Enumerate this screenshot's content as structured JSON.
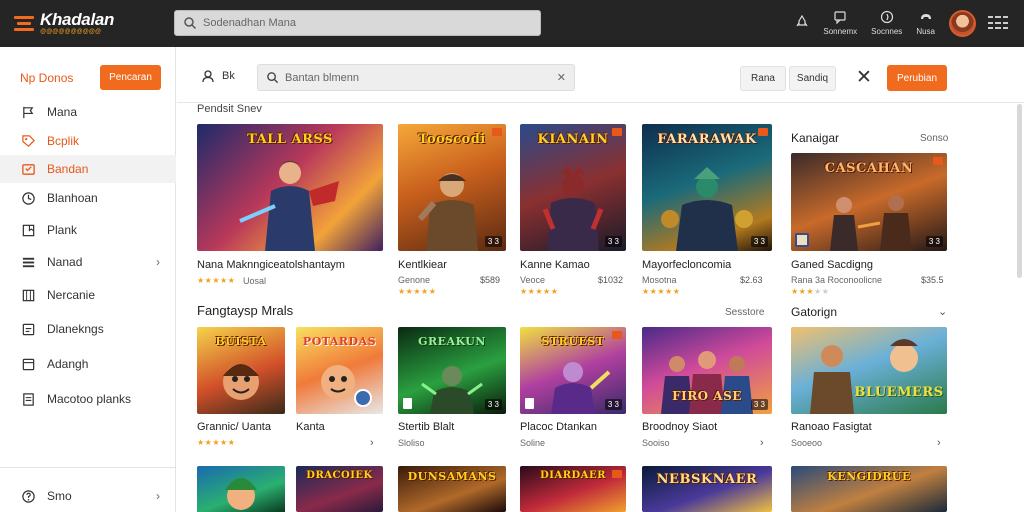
{
  "colors": {
    "accent": "#f06b1d",
    "topbar": "#252525",
    "sidebar_active_bg": "#f2f2f2",
    "star": "#f0a21d"
  },
  "app": {
    "title": "Khadalan",
    "tagline": "@@@@@@@@@@"
  },
  "top_search": {
    "placeholder": "Sodenadhan Mana"
  },
  "top_actions": [
    {
      "label": "",
      "icon": "rocket-icon"
    },
    {
      "label": "Sonnemx",
      "icon": "chat-icon"
    },
    {
      "label": "Socnnes",
      "icon": "compass-icon"
    },
    {
      "label": "Nusa",
      "icon": "controller-icon"
    }
  ],
  "sidebar": {
    "header_label": "Np Donos",
    "header_button": "Pencaran",
    "items": [
      {
        "label": "Mana",
        "icon": "flag-icon",
        "active": false
      },
      {
        "label": "Bcplik",
        "icon": "tag-icon",
        "active": false
      },
      {
        "label": "Bandan",
        "icon": "store-icon",
        "active": true
      },
      {
        "label": "Blanhoan",
        "icon": "clock-icon",
        "active": false
      },
      {
        "label": "Plank",
        "icon": "bookmark-icon",
        "active": false
      },
      {
        "label": "Nanad",
        "icon": "list-icon",
        "active": false,
        "chevron": true
      },
      {
        "label": "Nercanie",
        "icon": "grid-icon",
        "active": false
      },
      {
        "label": "Dlanekngs",
        "icon": "message-icon",
        "active": false
      },
      {
        "label": "Adangh",
        "icon": "card-icon",
        "active": false
      },
      {
        "label": "Macotoo planks",
        "icon": "document-icon",
        "active": false
      }
    ],
    "bottom_item": {
      "label": "Smo",
      "icon": "help-icon"
    }
  },
  "toolbar": {
    "user_label": "Bk",
    "search_placeholder": "Bantan blmenn",
    "btn1": "Rana",
    "btn2": "Sandiq",
    "primary": "Perubian"
  },
  "section1": {
    "label": "Pendsit Snev",
    "side_title": "Kanaigar",
    "side_link": "Sonso",
    "cards": [
      {
        "art": "TALL ARSS",
        "name": "Nana Maknngiceatolshantaym",
        "sub": "",
        "price": "",
        "stars": "★★★★★",
        "sub2": "Uosal",
        "badge": "",
        "bg": "linear-gradient(135deg,#1d2a6b 0%,#b8385a 45%,#f2a33a 75%,#402060 100%)"
      },
      {
        "art": "Tooscodi",
        "name": "Kentlkiear",
        "sub": "Genone",
        "price": "$589",
        "stars": "★★★★★",
        "badge": "3 3",
        "bg": "linear-gradient(160deg,#f5a83a 0%,#c9601d 45%,#5a2a12 100%)"
      },
      {
        "art": "KIANAIN",
        "name": "Kanne Kamao",
        "sub": "Veoce",
        "price": "$1032",
        "stars": "★★★★★",
        "badge": "3 3",
        "bg": "linear-gradient(160deg,#2a4a8a 0%,#8a3030 50%,#1a1a2a 100%)"
      },
      {
        "art": "FARARAWAK",
        "name": "Mayorfecloncomia",
        "sub": "Mosotna",
        "price": "$2.63",
        "stars": "★★★★★",
        "badge": "3 3",
        "bg": "linear-gradient(160deg,#0e2e4e 0%,#1a6a7a 45%,#b37a20 80%,#20140a 100%)"
      },
      {
        "art": "CASCAHAN",
        "name": "Ganed Sacdigng",
        "sub": "Rana 3a Roconoolicne",
        "price": "$35.5",
        "stars": "★★★★★",
        "badge": "3 3",
        "bg": "linear-gradient(160deg,#3a2a2a 0%,#c86a2a 50%,#241818 100%)"
      }
    ]
  },
  "section2": {
    "title": "Fangtaysp Mrals",
    "link": "Sesstore",
    "side_title": "Gatorign",
    "cards": [
      {
        "art": "BUISTA",
        "name": "Grannic/ Uanta",
        "sub": "",
        "price": "",
        "stars": "★★★★★",
        "badge": "",
        "bg": "linear-gradient(160deg,#f4d34a 0%,#d2502a 55%,#3a2a1a 100%)"
      },
      {
        "art": "POTARDAS",
        "name": "Kanta",
        "sub": "",
        "price": "",
        "stars": "",
        "badge": "",
        "bg": "linear-gradient(160deg,#f8e060 0%,#f07a3a 50%,#e8e8e8 100%)"
      },
      {
        "art": "GREAKUN",
        "name": "Stertib Blalt",
        "sub": "Sloliso",
        "price": "",
        "stars": "",
        "badge": "3 3",
        "bg": "linear-gradient(160deg,#0a2a12 0%,#2aa040 55%,#0a1a0a 100%)"
      },
      {
        "art": "STRUEST",
        "name": "Placoc Dtankan",
        "sub": "Soline",
        "price": "",
        "stars": "",
        "badge": "3 3",
        "bg": "linear-gradient(160deg,#f0e040 0%,#b040a0 50%,#3a2a6a 100%)"
      },
      {
        "art": "FIRO ASE",
        "name": "Broodnoy Siaot",
        "sub": "Sooiso",
        "price": "",
        "stars": "",
        "badge": "3 3",
        "bg": "linear-gradient(160deg,#4a2a8a 0%,#d04a9a 45%,#f0a040 100%)"
      },
      {
        "art": "BLUEMERS",
        "name": "Ranoao Fasigtat",
        "sub": "Sooeoo",
        "price": "",
        "stars": "",
        "badge": "",
        "bg": "linear-gradient(160deg,#f0c070 0%,#6ab0d8 45%,#2a7a4a 100%)"
      }
    ]
  },
  "section3": {
    "cards": [
      {
        "art": "",
        "bg": "linear-gradient(160deg,#1a6ab0 0%,#2ab070 60%,#0a3a20 100%)"
      },
      {
        "art": "DRACOIEK",
        "bg": "linear-gradient(160deg,#1a2a5a 0%,#8a2a4a 60%,#2a1a3a 100%)"
      },
      {
        "art": "DUNSAMANS",
        "bg": "linear-gradient(160deg,#3a1a0a 0%,#b06a2a 60%,#1a0a0a 100%)"
      },
      {
        "art": "DIARDAER",
        "bg": "linear-gradient(160deg,#2a0a1a 0%,#c02a3a 55%,#f0a030 100%)"
      },
      {
        "art": "NEBSKNAER",
        "bg": "linear-gradient(160deg,#0a1a3a 0%,#4a3a9a 55%,#f0c040 100%)"
      },
      {
        "art": "KENGIDRUE",
        "bg": "linear-gradient(160deg,#2a4a7a 0%,#c08040 55%,#1a2a3a 100%)"
      }
    ]
  }
}
